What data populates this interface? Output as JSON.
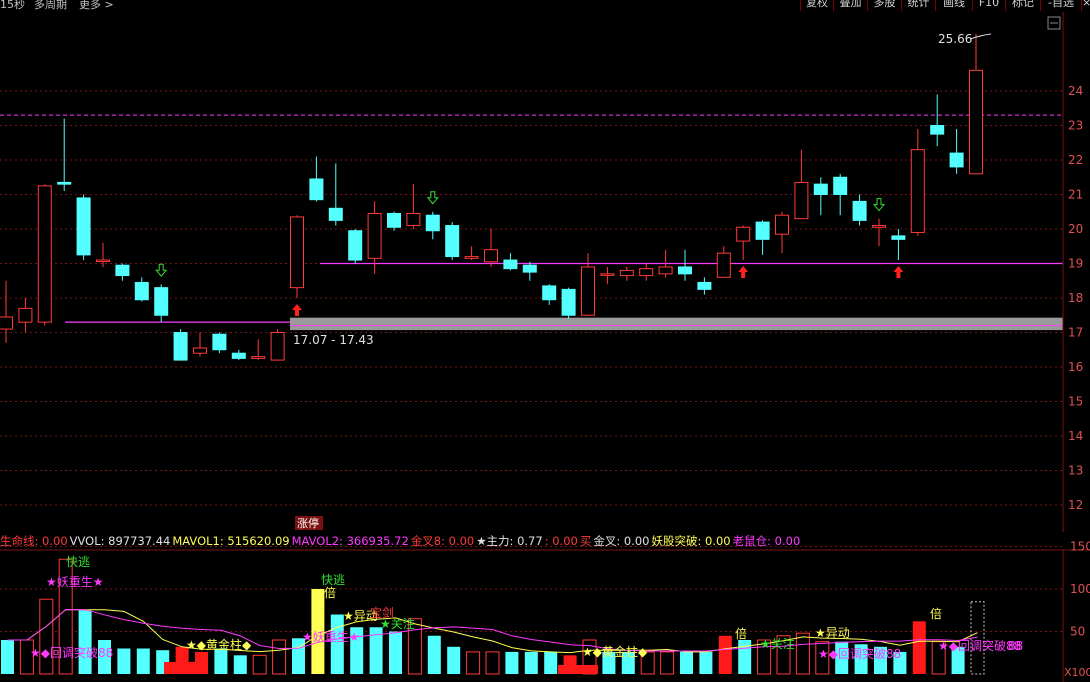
{
  "toolbar": {
    "period": "15秒",
    "multi_period": "多周期",
    "more": "更多 >",
    "buttons": [
      "复权",
      "叠加",
      "多股",
      "统计",
      "画线",
      "F10",
      "标记",
      "-自选"
    ]
  },
  "colors": {
    "up": "#ff3a3a",
    "down": "#54ffff",
    "magenta": "#ff3aff",
    "yellow": "#ffff54",
    "green": "#33dd33",
    "grid": "#7a1515",
    "support_band": "#9a9a9a"
  },
  "main": {
    "price_axis": [
      "24",
      "23",
      "22",
      "21",
      "20",
      "19",
      "18",
      "17",
      "16",
      "15",
      "14",
      "13",
      "12"
    ],
    "annotations": {
      "high_label": "25.66",
      "range_label": "17.07 - 17.43",
      "limit_up_tag": "涨停"
    },
    "candles": [
      {
        "o": 17.1,
        "c": 17.45,
        "h": 18.5,
        "l": 16.7
      },
      {
        "o": 17.3,
        "c": 17.7,
        "h": 18.0,
        "l": 17.0
      },
      {
        "o": 17.3,
        "c": 21.25,
        "h": 21.3,
        "l": 17.2
      },
      {
        "o": 21.35,
        "c": 21.3,
        "h": 23.2,
        "l": 21.1
      },
      {
        "o": 20.9,
        "c": 19.25,
        "h": 21.0,
        "l": 19.1
      },
      {
        "o": 19.1,
        "c": 19.1,
        "h": 19.6,
        "l": 18.9
      },
      {
        "o": 18.95,
        "c": 18.65,
        "h": 19.0,
        "l": 18.5
      },
      {
        "o": 18.45,
        "c": 17.95,
        "h": 18.6,
        "l": 17.9
      },
      {
        "o": 18.3,
        "c": 17.5,
        "h": 18.4,
        "l": 17.3
      },
      {
        "o": 17.0,
        "c": 16.2,
        "h": 17.1,
        "l": 16.2
      },
      {
        "o": 16.4,
        "c": 16.55,
        "h": 17.0,
        "l": 16.3
      },
      {
        "o": 16.95,
        "c": 16.5,
        "h": 17.0,
        "l": 16.4
      },
      {
        "o": 16.4,
        "c": 16.25,
        "h": 16.5,
        "l": 16.2
      },
      {
        "o": 16.25,
        "c": 16.3,
        "h": 16.8,
        "l": 16.2
      },
      {
        "o": 16.2,
        "c": 17.0,
        "h": 17.1,
        "l": 16.2
      },
      {
        "o": 18.3,
        "c": 20.35,
        "h": 20.4,
        "l": 18.0
      },
      {
        "o": 21.45,
        "c": 20.85,
        "h": 22.1,
        "l": 20.8
      },
      {
        "o": 20.6,
        "c": 20.25,
        "h": 21.9,
        "l": 20.1
      },
      {
        "o": 19.95,
        "c": 19.1,
        "h": 20.0,
        "l": 19.0
      },
      {
        "o": 19.15,
        "c": 20.45,
        "h": 20.8,
        "l": 18.7
      },
      {
        "o": 20.45,
        "c": 20.05,
        "h": 20.5,
        "l": 19.95
      },
      {
        "o": 20.1,
        "c": 20.45,
        "h": 21.3,
        "l": 20.0
      },
      {
        "o": 20.4,
        "c": 19.95,
        "h": 20.5,
        "l": 19.7
      },
      {
        "o": 20.1,
        "c": 19.2,
        "h": 20.2,
        "l": 19.1
      },
      {
        "o": 19.15,
        "c": 19.2,
        "h": 19.5,
        "l": 19.1
      },
      {
        "o": 19.05,
        "c": 19.4,
        "h": 20.0,
        "l": 18.9
      },
      {
        "o": 19.1,
        "c": 18.85,
        "h": 19.3,
        "l": 18.8
      },
      {
        "o": 18.95,
        "c": 18.75,
        "h": 19.05,
        "l": 18.5
      },
      {
        "o": 18.35,
        "c": 17.95,
        "h": 18.4,
        "l": 17.8
      },
      {
        "o": 18.25,
        "c": 17.5,
        "h": 18.3,
        "l": 17.4
      },
      {
        "o": 17.5,
        "c": 18.9,
        "h": 19.3,
        "l": 17.5
      },
      {
        "o": 18.7,
        "c": 18.7,
        "h": 18.9,
        "l": 18.4
      },
      {
        "o": 18.65,
        "c": 18.8,
        "h": 18.9,
        "l": 18.5
      },
      {
        "o": 18.65,
        "c": 18.85,
        "h": 19.0,
        "l": 18.5
      },
      {
        "o": 18.7,
        "c": 18.9,
        "h": 19.4,
        "l": 18.6
      },
      {
        "o": 18.9,
        "c": 18.7,
        "h": 19.4,
        "l": 18.5
      },
      {
        "o": 18.45,
        "c": 18.25,
        "h": 18.6,
        "l": 18.1
      },
      {
        "o": 18.6,
        "c": 19.3,
        "h": 19.5,
        "l": 18.6
      },
      {
        "o": 19.65,
        "c": 20.05,
        "h": 20.1,
        "l": 19.1
      },
      {
        "o": 20.2,
        "c": 19.7,
        "h": 20.25,
        "l": 19.25
      },
      {
        "o": 19.85,
        "c": 20.4,
        "h": 20.5,
        "l": 19.3
      },
      {
        "o": 20.3,
        "c": 21.35,
        "h": 22.3,
        "l": 20.3
      },
      {
        "o": 21.3,
        "c": 21.0,
        "h": 21.5,
        "l": 20.4
      },
      {
        "o": 21.5,
        "c": 21.0,
        "h": 21.6,
        "l": 20.4
      },
      {
        "o": 20.8,
        "c": 20.25,
        "h": 21.0,
        "l": 20.1
      },
      {
        "o": 20.05,
        "c": 20.1,
        "h": 20.3,
        "l": 19.5
      },
      {
        "o": 19.8,
        "c": 19.7,
        "h": 20.0,
        "l": 19.1
      },
      {
        "o": 19.9,
        "c": 22.3,
        "h": 22.9,
        "l": 19.8
      },
      {
        "o": 23.0,
        "c": 22.75,
        "h": 23.9,
        "l": 22.4
      },
      {
        "o": 22.2,
        "c": 21.8,
        "h": 22.9,
        "l": 21.6
      },
      {
        "o": 21.6,
        "c": 24.6,
        "h": 25.66,
        "l": 21.6
      }
    ],
    "up_arrows": [
      15,
      38,
      46
    ],
    "down_arrows": [
      8,
      22,
      45
    ],
    "support_level": 19.0,
    "band_low": 17.07,
    "band_high": 17.43,
    "pressure_level": 23.3
  },
  "indicators": {
    "items": [
      {
        "label": "生命线: 0.00",
        "color": "#ff3a3a"
      },
      {
        "label": "VVOL: 897737.44",
        "color": "#e0e0e0"
      },
      {
        "label": "MAVOL1: 515620.09",
        "color": "#ffff54"
      },
      {
        "label": "MAVOL2: 366935.72",
        "color": "#ff3aff"
      },
      {
        "label": "金叉8: 0.00",
        "color": "#ff3a3a"
      },
      {
        "label": "★主力: 0.77",
        "color": "#e0e0e0"
      },
      {
        "label": ": 0.00",
        "color": "#ff3a3a"
      },
      {
        "label": "买",
        "color": "#ff3a3a"
      },
      {
        "label": "金叉: 0.00",
        "color": "#e0e0e0"
      },
      {
        "label": "妖股突破: 0.00",
        "color": "#ffff54"
      },
      {
        "label": "老鼠仓: 0.00",
        "color": "#ff3aff"
      }
    ]
  },
  "volume": {
    "axis": [
      "150",
      "100",
      "50",
      "X100"
    ],
    "bars": [
      {
        "h": 40,
        "t": "c"
      },
      {
        "h": 40,
        "t": "o"
      },
      {
        "h": 88,
        "t": "o"
      },
      {
        "h": 135,
        "t": "o"
      },
      {
        "h": 75,
        "t": "c"
      },
      {
        "h": 40,
        "t": "c"
      },
      {
        "h": 30,
        "t": "c"
      },
      {
        "h": 30,
        "t": "c"
      },
      {
        "h": 28,
        "t": "c"
      },
      {
        "h": 32,
        "t": "r"
      },
      {
        "h": 26,
        "t": "r"
      },
      {
        "h": 30,
        "t": "c"
      },
      {
        "h": 22,
        "t": "c"
      },
      {
        "h": 22,
        "t": "o"
      },
      {
        "h": 40,
        "t": "o"
      },
      {
        "h": 42,
        "t": "c"
      },
      {
        "h": 100,
        "t": "y"
      },
      {
        "h": 70,
        "t": "c"
      },
      {
        "h": 55,
        "t": "c"
      },
      {
        "h": 55,
        "t": "c"
      },
      {
        "h": 50,
        "t": "c"
      },
      {
        "h": 65,
        "t": "o"
      },
      {
        "h": 45,
        "t": "c"
      },
      {
        "h": 32,
        "t": "c"
      },
      {
        "h": 26,
        "t": "o"
      },
      {
        "h": 26,
        "t": "o"
      },
      {
        "h": 26,
        "t": "c"
      },
      {
        "h": 26,
        "t": "c"
      },
      {
        "h": 26,
        "t": "c"
      },
      {
        "h": 22,
        "t": "r"
      },
      {
        "h": 40,
        "t": "o"
      },
      {
        "h": 26,
        "t": "c"
      },
      {
        "h": 26,
        "t": "c"
      },
      {
        "h": 26,
        "t": "o"
      },
      {
        "h": 26,
        "t": "o"
      },
      {
        "h": 26,
        "t": "c"
      },
      {
        "h": 26,
        "t": "c"
      },
      {
        "h": 45,
        "t": "r"
      },
      {
        "h": 40,
        "t": "c"
      },
      {
        "h": 40,
        "t": "o"
      },
      {
        "h": 45,
        "t": "o"
      },
      {
        "h": 48,
        "t": "o"
      },
      {
        "h": 38,
        "t": "o"
      },
      {
        "h": 38,
        "t": "c"
      },
      {
        "h": 35,
        "t": "c"
      },
      {
        "h": 32,
        "t": "c"
      },
      {
        "h": 26,
        "t": "c"
      },
      {
        "h": 62,
        "t": "r"
      },
      {
        "h": 38,
        "t": "o"
      },
      {
        "h": 32,
        "t": "c"
      },
      {
        "h": 85,
        "t": "d"
      }
    ],
    "signals": [
      {
        "text": "快逃",
        "color": "#33dd33"
      },
      {
        "text": "★妖重生★",
        "color": "#ff3aff"
      },
      {
        "text": "★◆回调突破88",
        "color": "#ff3aff"
      },
      {
        "text": "★◆黄金柱◆",
        "color": "#ffff54"
      },
      {
        "text": "快逃",
        "color": "#33dd33"
      },
      {
        "text": "倍",
        "color": "#ffff54"
      },
      {
        "text": "★妖重生★",
        "color": "#ff3aff"
      },
      {
        "text": "★异动",
        "color": "#ffff54"
      },
      {
        "text": "宝剑",
        "color": "#ff3a3a"
      },
      {
        "text": "★关注",
        "color": "#33dd33"
      },
      {
        "text": "★◆黄金柱◆",
        "color": "#ffff54"
      },
      {
        "text": "倍",
        "color": "#ffff54"
      },
      {
        "text": "★关注",
        "color": "#33dd33"
      },
      {
        "text": "★异动",
        "color": "#ffff54"
      },
      {
        "text": "★◆回调突破88",
        "color": "#ff3aff"
      },
      {
        "text": "倍",
        "color": "#ffff54"
      },
      {
        "text": "★◆回调突破88",
        "color": "#ff3aff"
      },
      {
        "text": "88",
        "color": "#ff3aff"
      }
    ]
  }
}
